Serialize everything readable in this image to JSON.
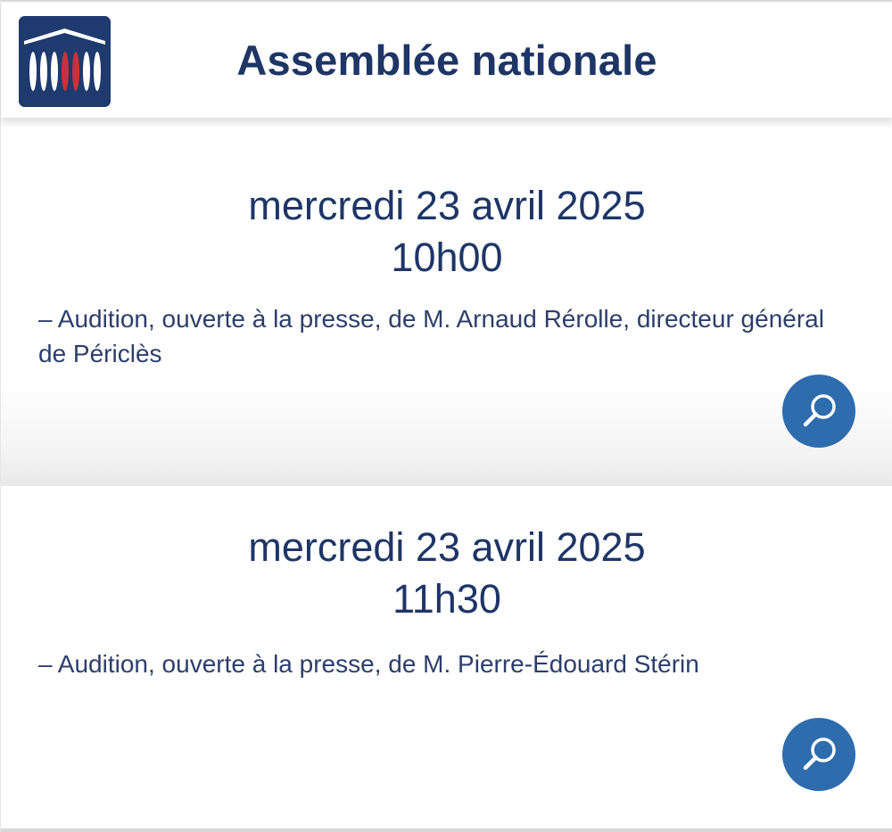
{
  "header": {
    "title": "Assemblée nationale",
    "logo_icon": "assemblee-nationale-logo"
  },
  "events": [
    {
      "date": "mercredi 23 avril 2025",
      "time": "10h00",
      "description": "– Audition, ouverte à la presse, de M. Arnaud Rérolle, directeur général de Périclès",
      "action_icon": "search-icon"
    },
    {
      "date": "mercredi 23 avril 2025",
      "time": "11h30",
      "description": "– Audition, ouverte à la presse, de M. Pierre-Édouard Stérin",
      "action_icon": "search-icon"
    }
  ],
  "colors": {
    "primary_text": "#1e3566",
    "logo_bg": "#1e3a6e",
    "logo_accent": "#c8323a",
    "button_bg": "#2e6cad"
  }
}
